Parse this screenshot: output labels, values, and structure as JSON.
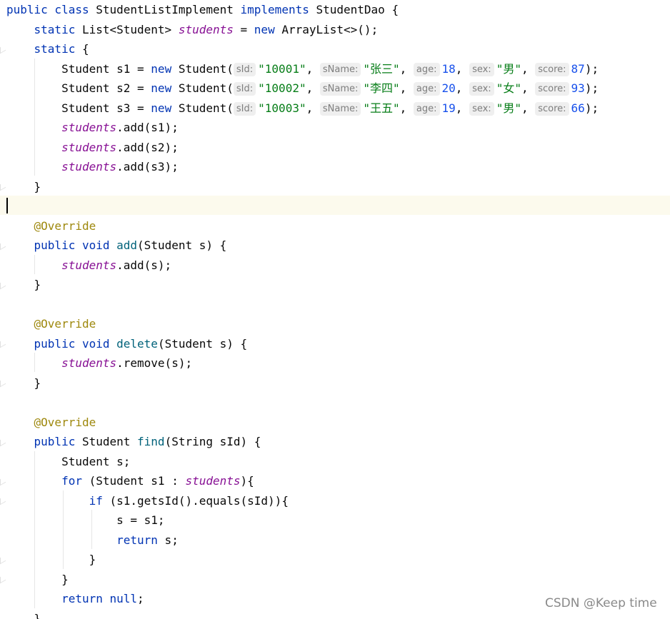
{
  "editor": {
    "watermark": "CSDN @Keep time",
    "colors": {
      "keyword": "#0033b3",
      "field": "#871094",
      "string": "#067d17",
      "number": "#1750eb",
      "annotation": "#9e880d",
      "method": "#00627a",
      "current_line": "#fcfaed"
    },
    "lines": [
      {
        "segments": [
          {
            "t": "public class",
            "c": "kw"
          },
          {
            "t": " StudentListImplement "
          },
          {
            "t": "implements",
            "c": "kw"
          },
          {
            "t": " StudentDao {"
          }
        ]
      },
      {
        "segments": [
          {
            "t": "    "
          },
          {
            "t": "static",
            "c": "kw"
          },
          {
            "t": " List<Student> "
          },
          {
            "t": "students",
            "c": "field"
          },
          {
            "t": " = "
          },
          {
            "t": "new",
            "c": "kw"
          },
          {
            "t": " ArrayList<>();"
          }
        ]
      },
      {
        "segments": [
          {
            "t": "    "
          },
          {
            "t": "static",
            "c": "kw"
          },
          {
            "t": " {"
          }
        ]
      },
      {
        "segments": [
          {
            "t": "        Student s1 = "
          },
          {
            "t": "new",
            "c": "kw"
          },
          {
            "t": " Student("
          },
          {
            "t": "sId:",
            "c": "hint"
          },
          {
            "t": "\"10001\"",
            "c": "str"
          },
          {
            "t": ", "
          },
          {
            "t": "sName:",
            "c": "hint"
          },
          {
            "t": "\"张三\"",
            "c": "str"
          },
          {
            "t": ", "
          },
          {
            "t": "age:",
            "c": "hint"
          },
          {
            "t": "18",
            "c": "num"
          },
          {
            "t": ", "
          },
          {
            "t": "sex:",
            "c": "hint"
          },
          {
            "t": "\"男\"",
            "c": "str"
          },
          {
            "t": ", "
          },
          {
            "t": "score:",
            "c": "hint"
          },
          {
            "t": "87",
            "c": "num"
          },
          {
            "t": ");"
          }
        ]
      },
      {
        "segments": [
          {
            "t": "        Student s2 = "
          },
          {
            "t": "new",
            "c": "kw"
          },
          {
            "t": " Student("
          },
          {
            "t": "sId:",
            "c": "hint"
          },
          {
            "t": "\"10002\"",
            "c": "str"
          },
          {
            "t": ", "
          },
          {
            "t": "sName:",
            "c": "hint"
          },
          {
            "t": "\"李四\"",
            "c": "str"
          },
          {
            "t": ", "
          },
          {
            "t": "age:",
            "c": "hint"
          },
          {
            "t": "20",
            "c": "num"
          },
          {
            "t": ", "
          },
          {
            "t": "sex:",
            "c": "hint"
          },
          {
            "t": "\"女\"",
            "c": "str"
          },
          {
            "t": ", "
          },
          {
            "t": "score:",
            "c": "hint"
          },
          {
            "t": "93",
            "c": "num"
          },
          {
            "t": ");"
          }
        ]
      },
      {
        "segments": [
          {
            "t": "        Student s3 = "
          },
          {
            "t": "new",
            "c": "kw"
          },
          {
            "t": " Student("
          },
          {
            "t": "sId:",
            "c": "hint"
          },
          {
            "t": "\"10003\"",
            "c": "str"
          },
          {
            "t": ", "
          },
          {
            "t": "sName:",
            "c": "hint"
          },
          {
            "t": "\"王五\"",
            "c": "str"
          },
          {
            "t": ", "
          },
          {
            "t": "age:",
            "c": "hint"
          },
          {
            "t": "19",
            "c": "num"
          },
          {
            "t": ", "
          },
          {
            "t": "sex:",
            "c": "hint"
          },
          {
            "t": "\"男\"",
            "c": "str"
          },
          {
            "t": ", "
          },
          {
            "t": "score:",
            "c": "hint"
          },
          {
            "t": "66",
            "c": "num"
          },
          {
            "t": ");"
          }
        ]
      },
      {
        "segments": [
          {
            "t": "        "
          },
          {
            "t": "students",
            "c": "field"
          },
          {
            "t": ".add(s1);"
          }
        ]
      },
      {
        "segments": [
          {
            "t": "        "
          },
          {
            "t": "students",
            "c": "field"
          },
          {
            "t": ".add(s2);"
          }
        ]
      },
      {
        "segments": [
          {
            "t": "        "
          },
          {
            "t": "students",
            "c": "field"
          },
          {
            "t": ".add(s3);"
          }
        ]
      },
      {
        "segments": [
          {
            "t": "    }"
          }
        ]
      },
      {
        "segments": []
      },
      {
        "segments": [
          {
            "t": "    "
          },
          {
            "t": "@Override",
            "c": "ann"
          }
        ]
      },
      {
        "segments": [
          {
            "t": "    "
          },
          {
            "t": "public void",
            "c": "kw"
          },
          {
            "t": " "
          },
          {
            "t": "add",
            "c": "method"
          },
          {
            "t": "(Student s) {"
          }
        ]
      },
      {
        "segments": [
          {
            "t": "        "
          },
          {
            "t": "students",
            "c": "field"
          },
          {
            "t": ".add(s);"
          }
        ]
      },
      {
        "segments": [
          {
            "t": "    }"
          }
        ]
      },
      {
        "segments": []
      },
      {
        "segments": [
          {
            "t": "    "
          },
          {
            "t": "@Override",
            "c": "ann"
          }
        ]
      },
      {
        "segments": [
          {
            "t": "    "
          },
          {
            "t": "public void",
            "c": "kw"
          },
          {
            "t": " "
          },
          {
            "t": "delete",
            "c": "method"
          },
          {
            "t": "(Student s) {"
          }
        ]
      },
      {
        "segments": [
          {
            "t": "        "
          },
          {
            "t": "students",
            "c": "field"
          },
          {
            "t": ".remove(s);"
          }
        ]
      },
      {
        "segments": [
          {
            "t": "    }"
          }
        ]
      },
      {
        "segments": []
      },
      {
        "segments": [
          {
            "t": "    "
          },
          {
            "t": "@Override",
            "c": "ann"
          }
        ]
      },
      {
        "segments": [
          {
            "t": "    "
          },
          {
            "t": "public",
            "c": "kw"
          },
          {
            "t": " Student "
          },
          {
            "t": "find",
            "c": "method"
          },
          {
            "t": "(String sId) {"
          }
        ]
      },
      {
        "segments": [
          {
            "t": "        Student s;"
          }
        ]
      },
      {
        "segments": [
          {
            "t": "        "
          },
          {
            "t": "for",
            "c": "kw"
          },
          {
            "t": " (Student s1 : "
          },
          {
            "t": "students",
            "c": "field"
          },
          {
            "t": "){"
          }
        ]
      },
      {
        "segments": [
          {
            "t": "            "
          },
          {
            "t": "if",
            "c": "kw"
          },
          {
            "t": " (s1.getsId().equals(sId)){"
          }
        ]
      },
      {
        "segments": [
          {
            "t": "                s = s1;"
          }
        ]
      },
      {
        "segments": [
          {
            "t": "                "
          },
          {
            "t": "return",
            "c": "kw"
          },
          {
            "t": " s;"
          }
        ]
      },
      {
        "segments": [
          {
            "t": "            }"
          }
        ]
      },
      {
        "segments": [
          {
            "t": "        }"
          }
        ]
      },
      {
        "segments": [
          {
            "t": "        "
          },
          {
            "t": "return null",
            "c": "kw"
          },
          {
            "t": ";"
          }
        ]
      },
      {
        "segments": [
          {
            "t": "    }"
          }
        ]
      }
    ]
  }
}
